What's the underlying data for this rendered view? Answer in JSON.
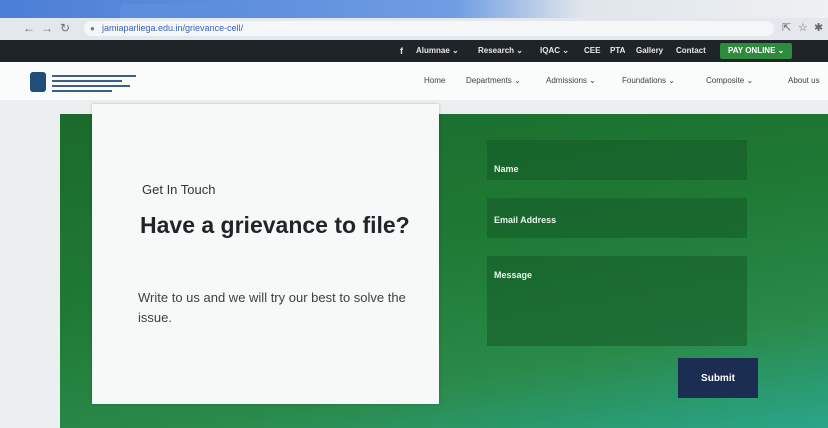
{
  "browser": {
    "url": "jamiaparliega.edu.in/grievance-cell/",
    "nav_back": "←",
    "nav_forward": "→",
    "nav_reload": "↻",
    "lock_icon": "lock-icon",
    "share_icon": "share-icon",
    "star_icon": "star-icon",
    "extension_icon": "puzzle-icon"
  },
  "top_nav": {
    "facebook": "f",
    "items": [
      {
        "label": "Alumnae ⌄"
      },
      {
        "label": "Research ⌄"
      },
      {
        "label": "IQAC ⌄"
      },
      {
        "label": "CEE"
      },
      {
        "label": "PTA"
      },
      {
        "label": "Gallery"
      },
      {
        "label": "Contact"
      }
    ],
    "pay_online": "PAY ONLINE ⌄",
    "accent": "#2e8a3d"
  },
  "main_nav": {
    "items": [
      {
        "label": "Home"
      },
      {
        "label": "Departments ⌄"
      },
      {
        "label": "Admissions ⌄"
      },
      {
        "label": "Foundations ⌄"
      },
      {
        "label": "Composite ⌄"
      },
      {
        "label": "About us"
      }
    ]
  },
  "hero": {
    "eyebrow": "Get In Touch",
    "heading": "Have a grievance to file?",
    "subtext": "Write to us and we will try our best to solve the issue.",
    "panel_color": "#1f7a35"
  },
  "form": {
    "name_label": "Name",
    "email_label": "Email Address",
    "message_label": "Message",
    "submit_label": "Submit",
    "submit_color": "#1c2d52"
  }
}
